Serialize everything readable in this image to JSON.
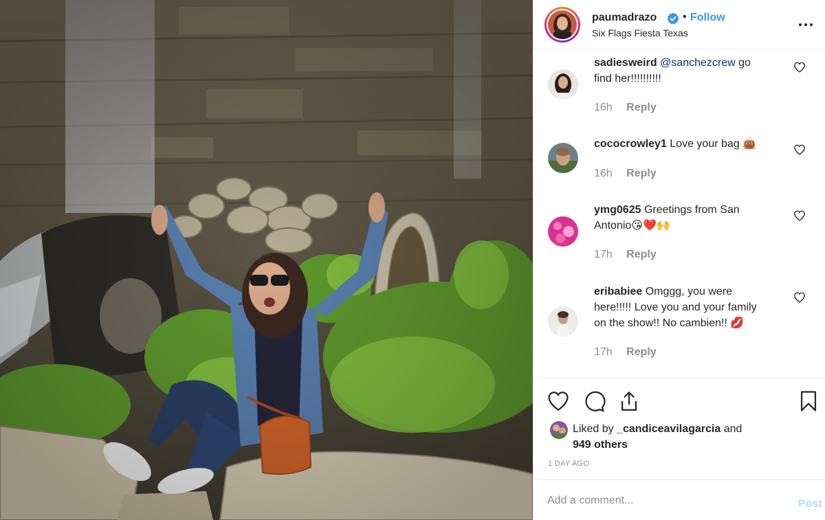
{
  "post": {
    "username": "paumadrazo",
    "verified_icon": "verified-badge-icon",
    "separator": "•",
    "follow_label": "Follow",
    "location": "Six Flags Fiesta Texas",
    "more_icon": "more-options-icon"
  },
  "comments": [
    {
      "user": "sadiesweird",
      "mention": "@sanchezcrew",
      "text_line1": " go",
      "text_line2": "find her!!!!!!!!!!",
      "time": "16h",
      "reply_label": "Reply"
    },
    {
      "user": "cococrowley1",
      "text": " Love your bag ",
      "emoji": "👜",
      "time": "16h",
      "reply_label": "Reply"
    },
    {
      "user": "ymg0625",
      "text_line1": " Greetings from San",
      "text_line2": "Antonio",
      "emoji": "😘❤️🙌",
      "time": "17h",
      "reply_label": "Reply"
    },
    {
      "user": "eribabiee",
      "text_line1": " Omggg, you were",
      "text_line2": "here!!!!! Love you and your family",
      "text_line3": "on the show!! No cambien!! ",
      "emoji": "💋",
      "time": "17h",
      "reply_label": "Reply"
    }
  ],
  "actions": {
    "like_icon": "heart-icon",
    "comment_icon": "comment-icon",
    "share_icon": "share-icon",
    "save_icon": "bookmark-icon",
    "liked_prefix": "Liked by ",
    "liked_user": "_candiceavilagarcia",
    "liked_middle": " and",
    "liked_count": "949 others",
    "timestamp": "1 DAY AGO"
  },
  "add_comment": {
    "placeholder": "Add a comment...",
    "post_label": "Post"
  },
  "colors": {
    "link_blue": "#3897f0",
    "mention_blue": "#003569",
    "muted_gray": "#8e8e8e",
    "post_disabled": "#b2dffc"
  }
}
